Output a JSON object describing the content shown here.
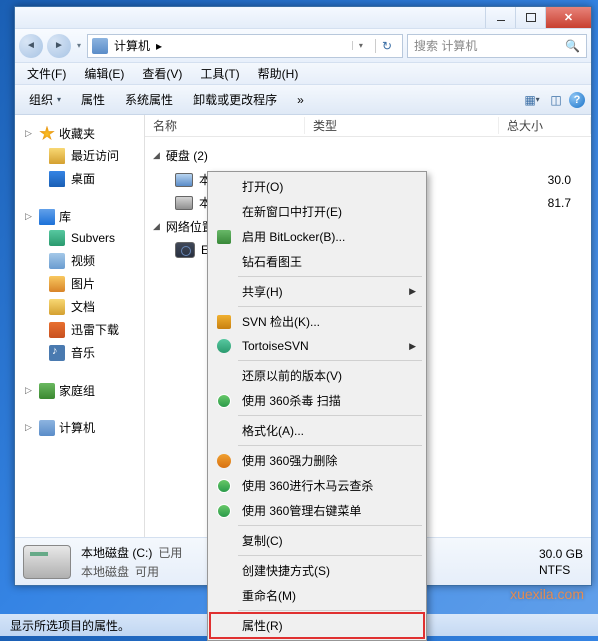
{
  "titlebar": {
    "close": "✕"
  },
  "nav": {
    "back": "◄",
    "forward": "►",
    "computer_label": "计算机",
    "crumb_arrow": "▸",
    "dropdown": "▾",
    "refresh": "↻"
  },
  "search": {
    "placeholder": "搜索 计算机",
    "icon": "🔍"
  },
  "menubar": {
    "file": "文件(F)",
    "edit": "编辑(E)",
    "view": "查看(V)",
    "tools": "工具(T)",
    "help": "帮助(H)"
  },
  "toolbar": {
    "organize": "组织",
    "properties": "属性",
    "system_properties": "系统属性",
    "uninstall": "卸载或更改程序",
    "chev": "»",
    "arrow": "▾",
    "help": "?"
  },
  "sidebar": {
    "favorites": {
      "label": "收藏夹",
      "caret": "▷",
      "items": [
        {
          "label": "最近访问"
        },
        {
          "label": "桌面"
        }
      ]
    },
    "libraries": {
      "label": "库",
      "caret": "▷",
      "items": [
        {
          "label": "Subvers"
        },
        {
          "label": "视频"
        },
        {
          "label": "图片"
        },
        {
          "label": "文档"
        },
        {
          "label": "迅雷下载"
        },
        {
          "label": "音乐"
        }
      ]
    },
    "homegroup": {
      "label": "家庭组",
      "caret": "▷"
    },
    "computer": {
      "label": "计算机",
      "caret": "▷"
    }
  },
  "columns": {
    "name": "名称",
    "type": "类型",
    "size": "总大小"
  },
  "content": {
    "disks": {
      "label": "硬盘 (2)",
      "caret": "◢",
      "items": [
        {
          "label": "本地磁",
          "size": "30.0"
        },
        {
          "label": "本地磁",
          "size": "81.7"
        }
      ]
    },
    "network": {
      "label": "网络位置",
      "caret": "◢",
      "items": [
        {
          "label": "ECap."
        }
      ]
    }
  },
  "context_menu": {
    "open": "打开(O)",
    "open_new_window": "在新窗口中打开(E)",
    "bitlocker": "启用 BitLocker(B)...",
    "diamond": "钻石看图王",
    "share": "共享(H)",
    "svn_checkout": "SVN 检出(K)...",
    "tortoisesvn": "TortoiseSVN",
    "previous_versions": "还原以前的版本(V)",
    "scan_360": "使用 360杀毒 扫描",
    "format": "格式化(A)...",
    "force_delete_360": "使用 360强力删除",
    "trojan_360": "使用 360进行木马云查杀",
    "rightclick_360": "使用 360管理右键菜单",
    "copy": "复制(C)",
    "create_shortcut": "创建快捷方式(S)",
    "rename": "重命名(M)",
    "properties": "属性(R)",
    "arrow": "▶"
  },
  "details": {
    "title": "本地磁盘 (C:)",
    "subtitle": "本地磁盘",
    "used_label": "已用",
    "avail_label": "可用",
    "total": "30.0 GB",
    "fs": "NTFS"
  },
  "status": {
    "text": "显示所选项目的属性。"
  },
  "watermark": "xuexila.com"
}
